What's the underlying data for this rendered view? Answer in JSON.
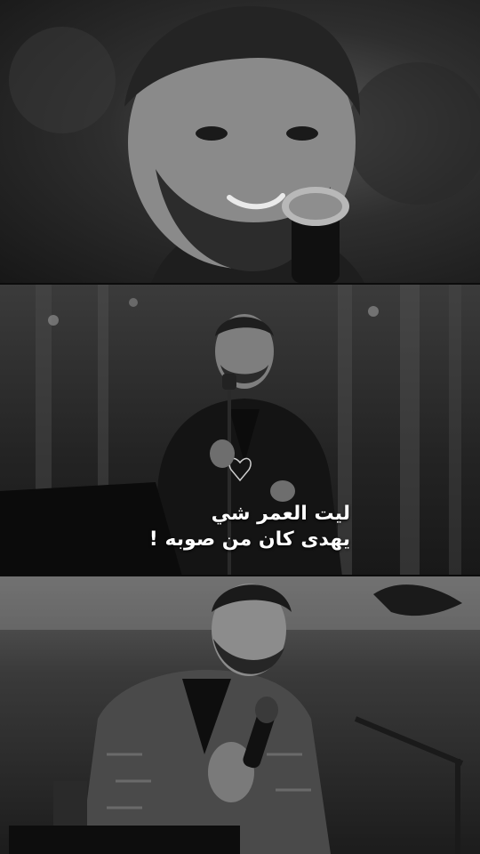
{
  "caption": {
    "line1": "ليت العمر شي",
    "line2": "يهدى كان من صوبه !"
  },
  "colors": {
    "text": "#ffffff",
    "tone": "grayscale"
  }
}
